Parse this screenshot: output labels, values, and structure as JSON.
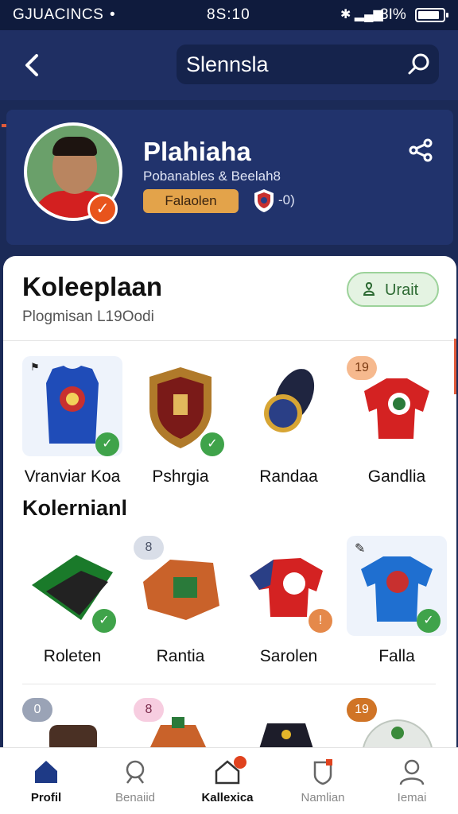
{
  "status_bar": {
    "carrier": "GJUACINCS",
    "time": "8S:10",
    "battery": "3I%"
  },
  "header": {
    "title": "Slennsla"
  },
  "profile": {
    "name": "Plahiaha",
    "subtitle": "Pobanables & Beelah8",
    "badge": "Falaolen",
    "stat": "-0)"
  },
  "collection": {
    "title": "Koleeplaan",
    "subtitle": "Plogmisan L19Oodi",
    "add_button": "Urait",
    "section2_title": "Kolernianl",
    "row1": [
      {
        "label": "Vranviar Koa",
        "corner": ""
      },
      {
        "label": "Pshrgia",
        "corner": ""
      },
      {
        "label": "Randaa",
        "corner": ""
      },
      {
        "label": "Gandlia",
        "corner": "19"
      }
    ],
    "row2": [
      {
        "label": "Roleten",
        "corner": ""
      },
      {
        "label": "Rantia",
        "corner": "8"
      },
      {
        "label": "Sarolen",
        "corner": ""
      },
      {
        "label": "Falla",
        "corner": ""
      }
    ],
    "row3": [
      {
        "corner": "0"
      },
      {
        "corner": "8"
      },
      {
        "corner": ""
      },
      {
        "corner": "19"
      }
    ]
  },
  "bottom_nav": [
    {
      "label": "Profil",
      "icon": "home-icon",
      "active": true
    },
    {
      "label": "Benaiid",
      "icon": "search-icon",
      "active": false
    },
    {
      "label": "Kallexica",
      "icon": "collection-icon",
      "active": false
    },
    {
      "label": "Namlian",
      "icon": "badge-icon",
      "active": false
    },
    {
      "label": "Iemai",
      "icon": "user-icon",
      "active": false
    }
  ],
  "colors": {
    "navy": "#1b2a57",
    "accent": "#e05a3a",
    "green": "#3fa34a",
    "white": "#ffffff"
  }
}
